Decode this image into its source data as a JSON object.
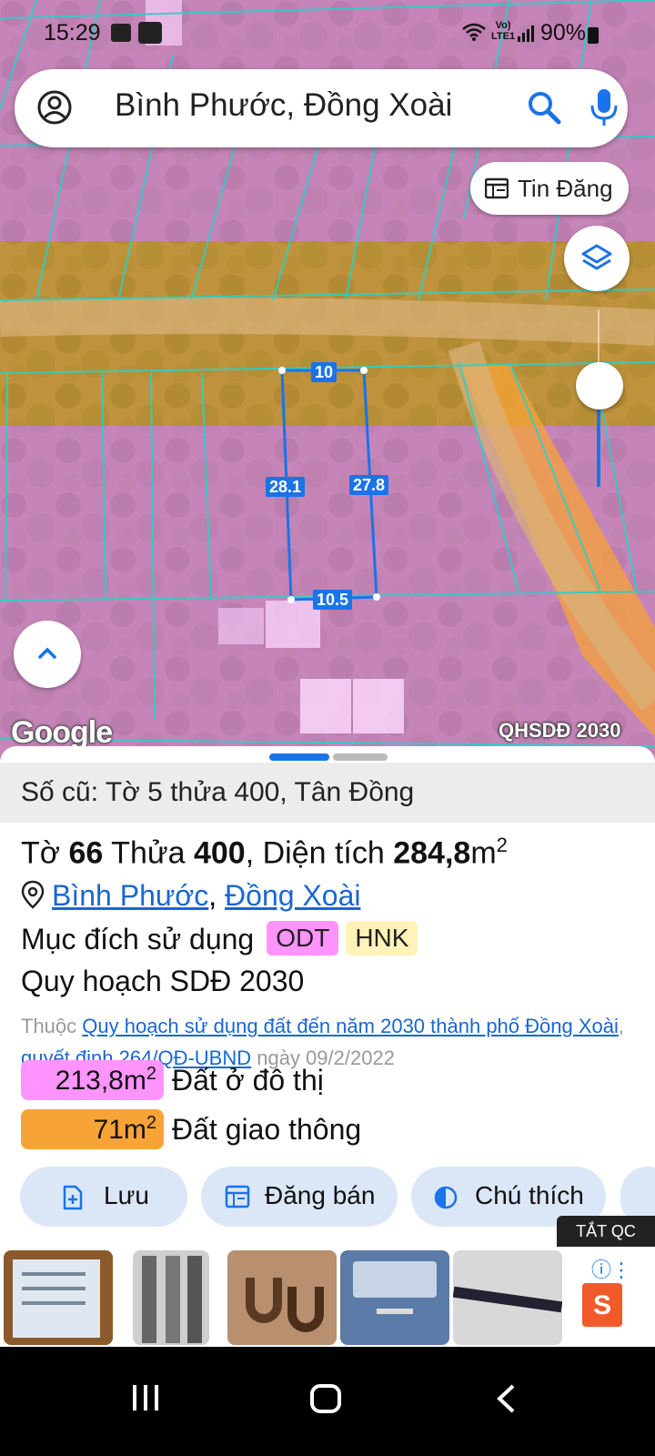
{
  "status_bar": {
    "time": "15:29",
    "network_label_1": "Vo)",
    "network_label_2": "LTE1",
    "battery": "90%"
  },
  "search": {
    "query": "Bình Phước, Đồng Xoài"
  },
  "map": {
    "tin_dang_label": "Tin Đăng",
    "plan_overlay_label": "QHSDĐ 2030",
    "google_label": "Google",
    "measurements": {
      "top": "10",
      "left": "28.1",
      "right": "27.8",
      "bottom": "10.5"
    },
    "overlay_colors": {
      "residential": "#ff8cff",
      "traffic": "#f7a338",
      "parcel_border": "#1a73e8"
    }
  },
  "sheet": {
    "old_id": "Số cũ: Tờ 5 thửa 400, Tân Đồng",
    "title": {
      "prefix_to": "Tờ ",
      "to_number": "66",
      "prefix_thua": " Thửa ",
      "thua_number": "400",
      "prefix_area": ", Diện tích ",
      "area_value": "284,8",
      "area_unit": "m",
      "area_sup": "2"
    },
    "location": {
      "province": "Bình Phước",
      "separator": ", ",
      "city": "Đồng Xoài"
    },
    "purpose_label": "Mục đích sử dụng",
    "purpose_tags": [
      "ODT",
      "HNK"
    ],
    "plan_title": "Quy hoạch SDĐ 2030",
    "decision": {
      "prefix": "Thuộc ",
      "plan_link": "Quy hoạch sử dụng đất đến năm 2030 thành phố Đồng Xoài",
      "separator": ", ",
      "decision_link": "quyết định 264/QĐ-UBND",
      "date_text": " ngày 09/2/2022"
    },
    "areas": [
      {
        "value": "213,8m",
        "sup": "2",
        "label": "Đất ở đô thị",
        "color": "#ff94ff"
      },
      {
        "value": "71m",
        "sup": "2",
        "label": "Đất giao thông",
        "color": "#f7a338"
      }
    ],
    "actions": {
      "save": "Lưu",
      "sell": "Đăng bán",
      "legend": "Chú thích"
    }
  },
  "ads": {
    "close_label": "TẮT QC",
    "shop_letter": "S"
  }
}
